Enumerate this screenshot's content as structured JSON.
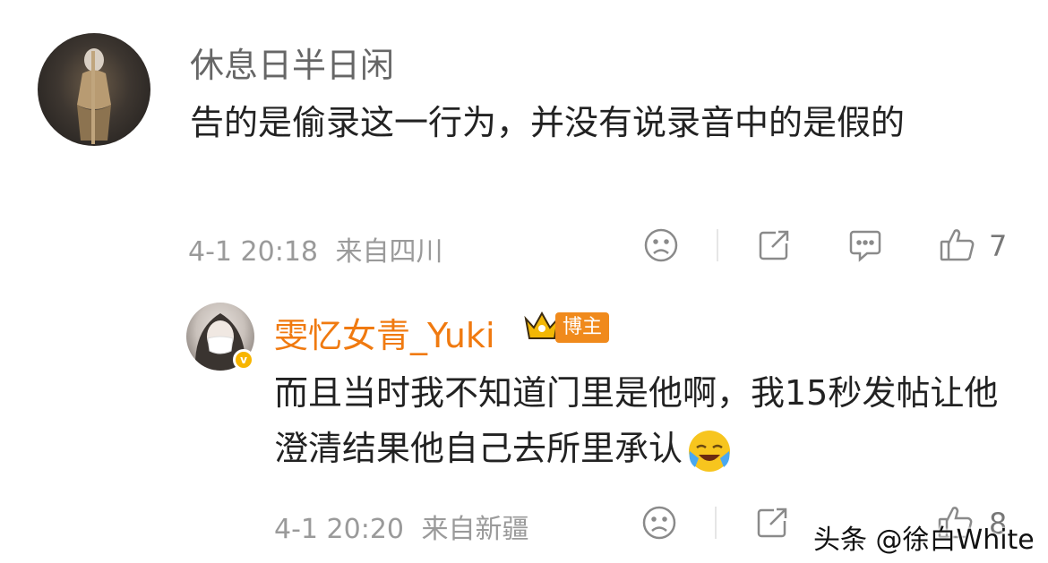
{
  "comment": {
    "username": "休息日半日闲",
    "text": "告的是偷录这一行为，并没有说录音中的是假的",
    "date": "4-1 20:18",
    "location": "来自四川",
    "like_count": "7"
  },
  "reply": {
    "username": "雯忆女青_Yuki",
    "badge": "博主",
    "text": "而且当时我不知道门里是他啊，我15秒发帖让他澄清结果他自己去所里承认",
    "emoji": "laugh-cry-emoji",
    "date": "4-1 20:20",
    "location": "来自新疆",
    "like_count": "8"
  },
  "watermark": "头条 @徐白White",
  "icons": {
    "dislike": "sad-face-icon",
    "share": "share-icon",
    "reply": "comment-icon",
    "like": "thumbs-up-icon",
    "crown": "crown-icon",
    "verified": "verified-icon"
  },
  "colors": {
    "accent": "#f07a10",
    "meta_gray": "#9a9a9a",
    "verified": "#f7b500"
  }
}
